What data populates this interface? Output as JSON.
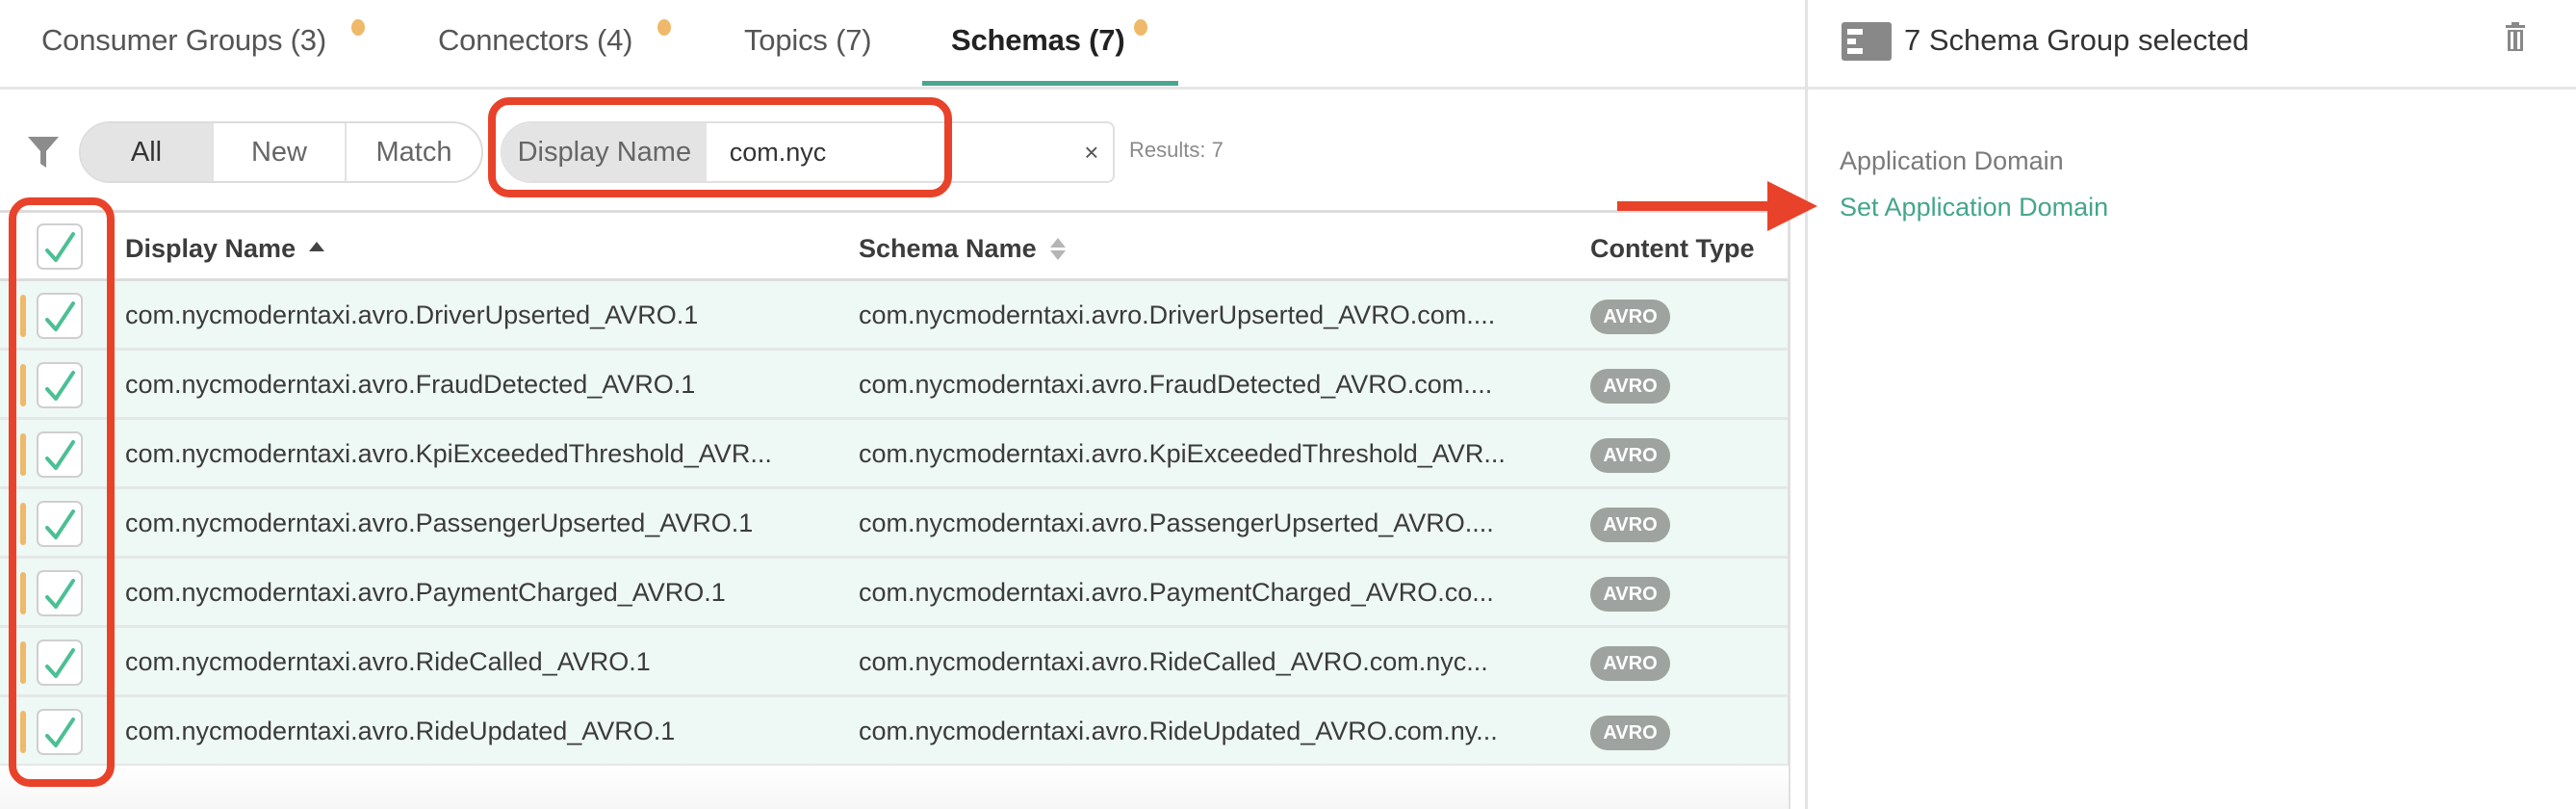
{
  "tabs": [
    {
      "label": "Consumer Groups (3)",
      "has_dot": true,
      "active": false
    },
    {
      "label": "Connectors (4)",
      "has_dot": true,
      "active": false
    },
    {
      "label": "Topics (7)",
      "has_dot": false,
      "active": false
    },
    {
      "label": "Schemas (7)",
      "has_dot": true,
      "active": true
    }
  ],
  "filter": {
    "icon": "filter-icon",
    "segments": [
      {
        "label": "All",
        "active": true
      },
      {
        "label": "New",
        "active": false
      },
      {
        "label": "Match",
        "active": false
      }
    ],
    "search_field_label": "Display Name",
    "search_value": "com.nyc",
    "clear_symbol": "×",
    "results_text": "Results: 7"
  },
  "table": {
    "columns": [
      {
        "label": "Display Name",
        "sort": "ascending"
      },
      {
        "label": "Schema Name",
        "sort": "none"
      },
      {
        "label": "Content Type",
        "sort": null
      }
    ],
    "select_all_checked": true,
    "rows": [
      {
        "display_name": "com.nycmoderntaxi.avro.DriverUpserted_AVRO.1",
        "schema_name": "com.nycmoderntaxi.avro.DriverUpserted_AVRO.com....",
        "content_type": "AVRO",
        "checked": true
      },
      {
        "display_name": "com.nycmoderntaxi.avro.FraudDetected_AVRO.1",
        "schema_name": "com.nycmoderntaxi.avro.FraudDetected_AVRO.com....",
        "content_type": "AVRO",
        "checked": true
      },
      {
        "display_name": "com.nycmoderntaxi.avro.KpiExceededThreshold_AVR...",
        "schema_name": "com.nycmoderntaxi.avro.KpiExceededThreshold_AVR...",
        "content_type": "AVRO",
        "checked": true
      },
      {
        "display_name": "com.nycmoderntaxi.avro.PassengerUpserted_AVRO.1",
        "schema_name": "com.nycmoderntaxi.avro.PassengerUpserted_AVRO....",
        "content_type": "AVRO",
        "checked": true
      },
      {
        "display_name": "com.nycmoderntaxi.avro.PaymentCharged_AVRO.1",
        "schema_name": "com.nycmoderntaxi.avro.PaymentCharged_AVRO.co...",
        "content_type": "AVRO",
        "checked": true
      },
      {
        "display_name": "com.nycmoderntaxi.avro.RideCalled_AVRO.1",
        "schema_name": "com.nycmoderntaxi.avro.RideCalled_AVRO.com.nyc...",
        "content_type": "AVRO",
        "checked": true
      },
      {
        "display_name": "com.nycmoderntaxi.avro.RideUpdated_AVRO.1",
        "schema_name": "com.nycmoderntaxi.avro.RideUpdated_AVRO.com.ny...",
        "content_type": "AVRO",
        "checked": true
      }
    ]
  },
  "panel": {
    "title": "7 Schema Group selected",
    "field_label": "Application Domain",
    "set_link": "Set Application Domain"
  },
  "colors": {
    "accent": "#45a58c",
    "tab_underline": "#4aa68f",
    "notification_dot": "#efb969",
    "row_selected_bg": "#eef8f4",
    "badge_bg": "#9ea3a0",
    "annotation_red": "#e8432a"
  }
}
